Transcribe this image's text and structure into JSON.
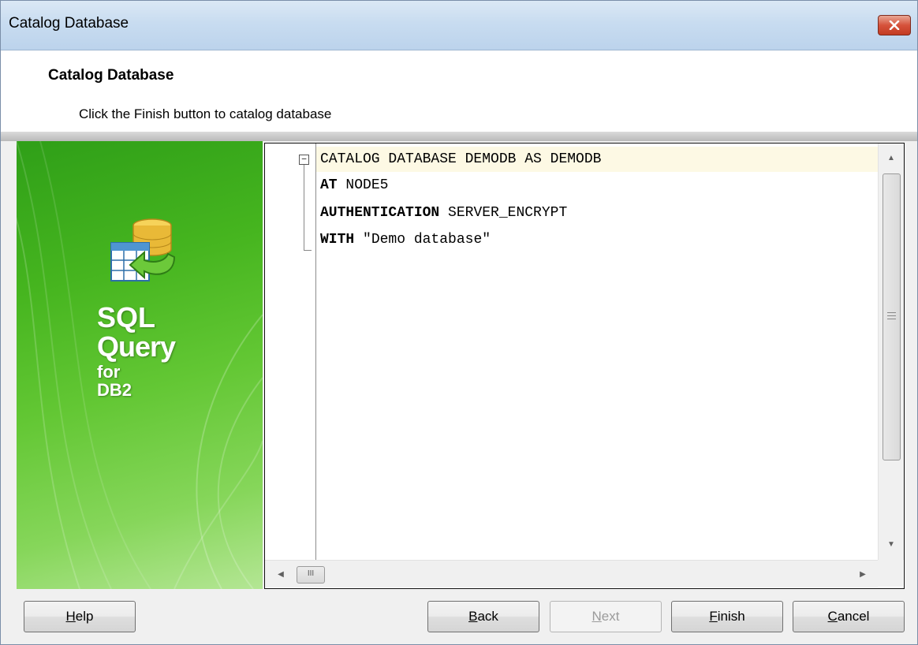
{
  "window": {
    "title": "Catalog Database",
    "close_icon": "close-icon"
  },
  "header": {
    "title": "Catalog Database",
    "description": "Click the Finish button to catalog database"
  },
  "sidebar": {
    "logo_icon": "database-import-icon",
    "brand_line1": "SQL",
    "brand_line2": "Query",
    "brand_line3": "for",
    "brand_line4": "DB2",
    "gradient_colors": [
      "#2f9f18",
      "#63c734",
      "#b4e694"
    ]
  },
  "editor": {
    "lines": [
      "CATALOG DATABASE DEMODB AS DEMODB",
      "AT NODE5",
      "AUTHENTICATION SERVER_ENCRYPT",
      "WITH \"Demo database\""
    ],
    "current_line_color": "#fdf9e4"
  },
  "buttons": {
    "help": {
      "label_u": "H",
      "label_rest": "elp"
    },
    "back": {
      "label_u": "B",
      "label_rest": "ack"
    },
    "next": {
      "label_u": "N",
      "label_rest": "ext",
      "enabled": false
    },
    "finish": {
      "label_u": "F",
      "label_rest": "inish"
    },
    "cancel": {
      "label_u": "C",
      "label_rest": "ancel"
    }
  }
}
